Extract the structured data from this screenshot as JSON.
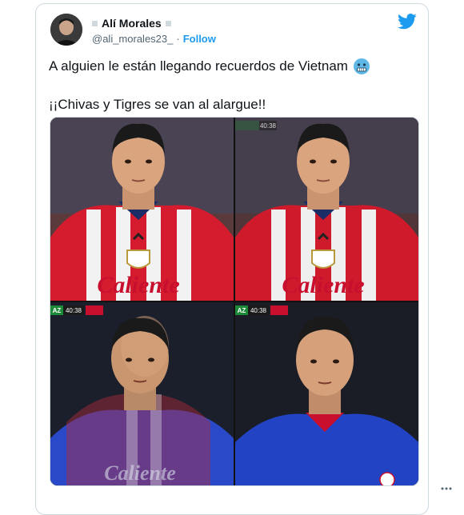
{
  "tweet": {
    "display_name": "Alí Morales",
    "handle": "@ali_morales23_",
    "separator": "·",
    "follow_label": "Follow",
    "text_line1": "A alguien le están llegando recuerdos de Vietnam",
    "text_line2": "¡¡Chivas y Tigres se van al alargue!!"
  },
  "media": {
    "tiles": [
      {
        "jersey": "chivas",
        "scoreboard": ""
      },
      {
        "jersey": "chivas",
        "scoreboard": "40:38"
      },
      {
        "jersey": "blended",
        "scoreboard": "40:38"
      },
      {
        "jersey": "cruz-azul",
        "scoreboard": "40:38"
      }
    ],
    "sponsor": "Caliente",
    "scoreboard_team": "AZ"
  },
  "colors": {
    "twitter_blue": "#1d9bf0",
    "chivas_red": "#c8102e",
    "cruz_azul_blue": "#1f3fbf"
  }
}
